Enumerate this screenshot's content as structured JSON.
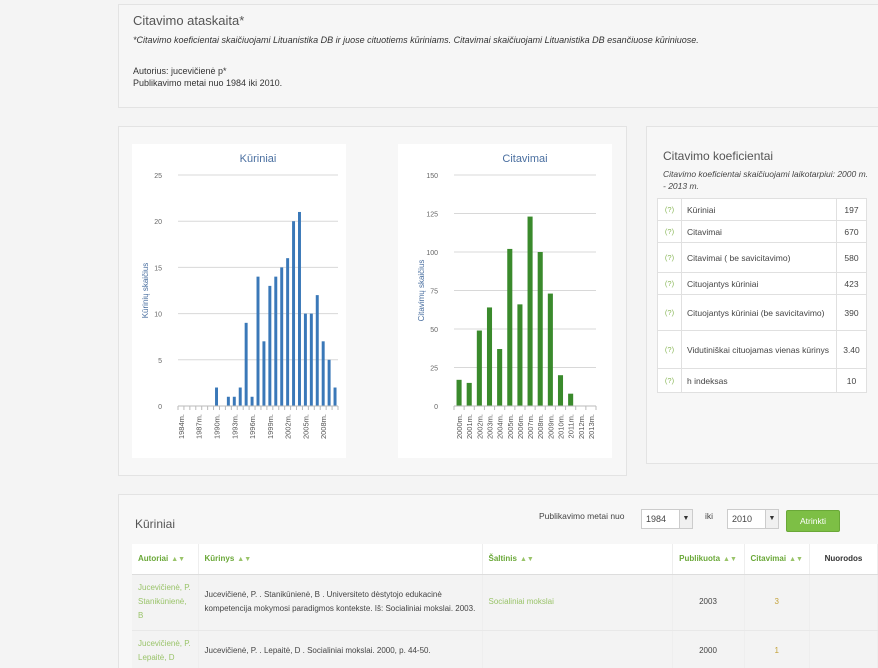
{
  "report": {
    "title": "Citavimo ataskaita*",
    "note": "*Citavimo koeficientai skaičiuojami Lituanistika DB ir juose cituotiems kūriniams. Citavimai skaičiuojami Lituanistika DB esančiuose kūriniuose.",
    "author": "Autorius: jucevičienė p*",
    "years": "Publikavimo metai nuo 1984 iki 2010."
  },
  "chart_data": [
    {
      "type": "bar",
      "title": "Kūriniai",
      "ylabel": "Kūrinių skaičius",
      "ylim": [
        0,
        25
      ],
      "yticks": [
        0,
        5,
        10,
        15,
        20,
        25
      ],
      "color": "#3a78b8",
      "tick_labels": [
        "1984m.",
        "1987m.",
        "1990m.",
        "1993m.",
        "1996m.",
        "1999m.",
        "2002m.",
        "2005m.",
        "2008m."
      ],
      "categories": [
        "1984",
        "1985",
        "1986",
        "1987",
        "1988",
        "1989",
        "1990",
        "1991",
        "1992",
        "1993",
        "1994",
        "1995",
        "1996",
        "1997",
        "1998",
        "1999",
        "2000",
        "2001",
        "2002",
        "2003",
        "2004",
        "2005",
        "2006",
        "2007",
        "2008",
        "2009",
        "2010"
      ],
      "values": [
        0,
        0,
        0,
        0,
        0,
        0,
        2,
        0,
        1,
        1,
        2,
        9,
        1,
        14,
        7,
        13,
        14,
        15,
        16,
        20,
        21,
        10,
        10,
        12,
        7,
        5,
        2
      ]
    },
    {
      "type": "bar",
      "title": "Citavimai",
      "ylabel": "Citavimų skaičius",
      "ylim": [
        0,
        150
      ],
      "yticks": [
        0,
        25,
        50,
        75,
        100,
        125,
        150
      ],
      "color": "#3a8a2c",
      "tick_labels": [
        "2000m.",
        "2001m.",
        "2002m.",
        "2003m.",
        "2004m.",
        "2005m.",
        "2006m.",
        "2007m.",
        "2008m.",
        "2009m.",
        "2010m.",
        "2011m.",
        "2012m.",
        "2013m."
      ],
      "categories": [
        "2000",
        "2001",
        "2002",
        "2003",
        "2004",
        "2005",
        "2006",
        "2007",
        "2008",
        "2009",
        "2010",
        "2011",
        "2012",
        "2013"
      ],
      "values": [
        17,
        15,
        49,
        64,
        37,
        102,
        66,
        123,
        100,
        73,
        20,
        8,
        0,
        0
      ]
    }
  ],
  "coefficients": {
    "title": "Citavimo koeficientai",
    "note": "Citavimo koeficientai skaičiuojami laikotarpiui: 2000 m. - 2013 m.",
    "help": "(?)",
    "rows": [
      {
        "label": "Kūriniai",
        "value": "197"
      },
      {
        "label": "Citavimai",
        "value": "670"
      },
      {
        "label": "Citavimai ( be savicitavimo)",
        "value": "580"
      },
      {
        "label": "Cituojantys kūriniai",
        "value": "423"
      },
      {
        "label": "Cituojantys kūriniai (be savicitavimo)",
        "value": "390"
      },
      {
        "label": "Vidutiniškai cituojamas vienas kūrinys",
        "value": "3.40"
      },
      {
        "label": "h indeksas",
        "value": "10"
      }
    ]
  },
  "works": {
    "title": "Kūriniai",
    "filter_label": "Publikavimo metai nuo",
    "from_year": "1984",
    "to_label": "iki",
    "to_year": "2010",
    "button": "Atrinkti",
    "columns": [
      "Autoriai",
      "Kūrinys",
      "Šaltinis",
      "Publikuota",
      "Citavimai",
      "Nuorodos"
    ],
    "rows": [
      {
        "authors": "Jucevičienė, P. Stanikūnienė, B",
        "work": "Jucevičienė, P. . Stanikūnienė, B . Universiteto dėstytojo edukacinė kompetencija mokymosi paradigmos kontekste. Iš: Socialiniai mokslai. 2003.",
        "source": "Socialiniai mokslai",
        "published": "2003",
        "citations": "3"
      },
      {
        "authors": "Jucevičienė, P. Lepaitė, D",
        "work": "Jucevičienė, P. . Lepaitė, D . Socialiniai mokslai. 2000, p. 44-50.",
        "source": "",
        "published": "2000",
        "citations": "1"
      }
    ]
  }
}
